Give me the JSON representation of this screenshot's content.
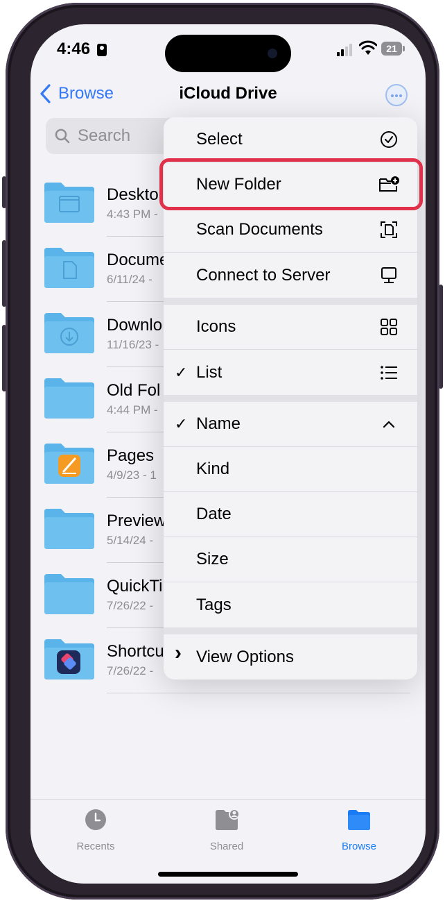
{
  "status": {
    "time": "4:46",
    "battery": "21"
  },
  "nav": {
    "back_label": "Browse",
    "title": "iCloud Drive"
  },
  "search": {
    "placeholder": "Search"
  },
  "files": [
    {
      "name": "Deskto",
      "meta": "4:43 PM -"
    },
    {
      "name": "Docume",
      "meta": "6/11/24 -"
    },
    {
      "name": "Downlo",
      "meta": "11/16/23 -"
    },
    {
      "name": "Old Fol",
      "meta": "4:44 PM -"
    },
    {
      "name": "Pages",
      "meta": "4/9/23 - 1"
    },
    {
      "name": "Preview",
      "meta": "5/14/24 -"
    },
    {
      "name": "QuickTi",
      "meta": "7/26/22 -"
    },
    {
      "name": "Shortcu",
      "meta": "7/26/22 -"
    }
  ],
  "menu": {
    "select": "Select",
    "new_folder": "New Folder",
    "scan_documents": "Scan Documents",
    "connect_to_server": "Connect to Server",
    "icons": "Icons",
    "list": "List",
    "name": "Name",
    "kind": "Kind",
    "date": "Date",
    "size": "Size",
    "tags": "Tags",
    "view_options": "View Options",
    "check_mark": "✓",
    "chevron_right": "›"
  },
  "tabs": {
    "recents": "Recents",
    "shared": "Shared",
    "browse": "Browse"
  },
  "colors": {
    "accent": "#3478f6",
    "highlight": "#e0304a",
    "folder": "#5ab4ea"
  }
}
